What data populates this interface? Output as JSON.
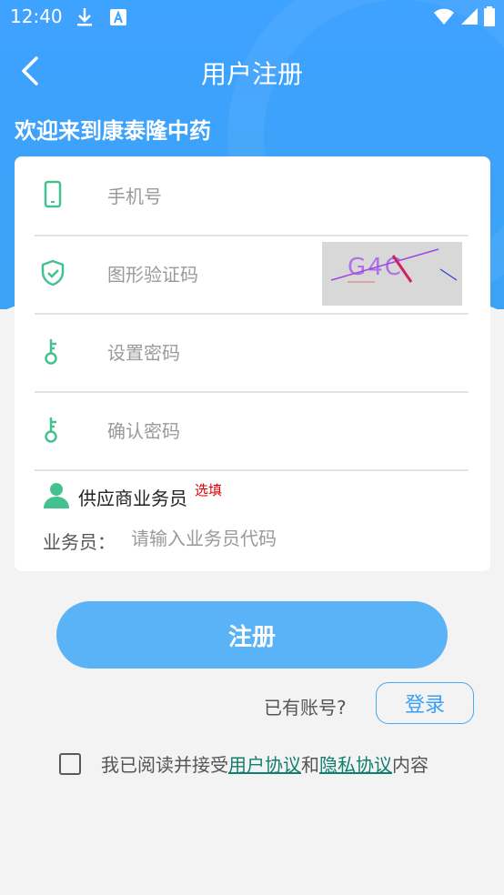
{
  "status_bar": {
    "time": "12:40",
    "icons_left": [
      "download-icon",
      "font-icon"
    ],
    "icons_right": [
      "wifi-icon",
      "signal-icon",
      "battery-icon"
    ]
  },
  "nav": {
    "back_icon": "chevron-left-icon",
    "title": "用户注册"
  },
  "welcome": "欢迎来到康泰隆中药",
  "form": {
    "phone": {
      "placeholder": "手机号",
      "icon": "phone-icon"
    },
    "captcha": {
      "placeholder": "图形验证码",
      "icon": "shield-check-icon",
      "code": "G4C"
    },
    "password": {
      "placeholder": "设置密码",
      "icon": "key-icon"
    },
    "confirm_password": {
      "placeholder": "确认密码",
      "icon": "key-icon"
    },
    "supplier": {
      "label": "供应商业务员",
      "optional": "选填",
      "icon": "person-icon"
    },
    "salesman": {
      "label": "业务员：",
      "placeholder": "请输入业务员代码"
    }
  },
  "register_button": "注册",
  "account": {
    "prompt": "已有账号?",
    "login_button": "登录"
  },
  "agreement": {
    "prefix": "我已阅读并接受",
    "user_agreement": "用户协议",
    "and": "和",
    "privacy_agreement": "隐私协议",
    "suffix": "内容",
    "checked": false
  },
  "colors": {
    "primary": "#3ea2ff",
    "accent_green": "#43c28f",
    "link": "#127e6e",
    "optional_red": "#e10000"
  }
}
